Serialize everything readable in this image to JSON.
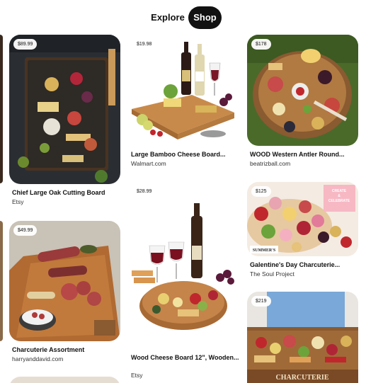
{
  "tabs": {
    "explore": "Explore",
    "shop": "Shop"
  },
  "pins": [
    {
      "price": "$89.99",
      "title": "Chief Large Oak Cutting Board",
      "source": "Etsy"
    },
    {
      "price": "$49.99",
      "title": "Charcuterie Assortment",
      "source": "harryanddavid.com"
    },
    {
      "price": "$19.98",
      "title": "Large Bamboo Cheese Board...",
      "source": "Walmart.com"
    },
    {
      "price": "$28.99",
      "title": "Wood Cheese Board 12\", Wooden...",
      "source": "Etsy"
    },
    {
      "price": "$178",
      "title": "WOOD Western Antler Round...",
      "source": "beatrizball.com"
    },
    {
      "price": "$125",
      "title": "Galentine's Day Charcuterie...",
      "source": "The Soul Project"
    },
    {
      "price": "$219"
    }
  ],
  "images": {
    "galentine_badge": [
      "CREATE",
      "&",
      "CELEBRATE"
    ],
    "galentine_logo": "SUMMER'S",
    "wood_board_text": "CHARCUTERIE"
  },
  "colors": {
    "accent": "#111111",
    "background": "#ffffff"
  }
}
